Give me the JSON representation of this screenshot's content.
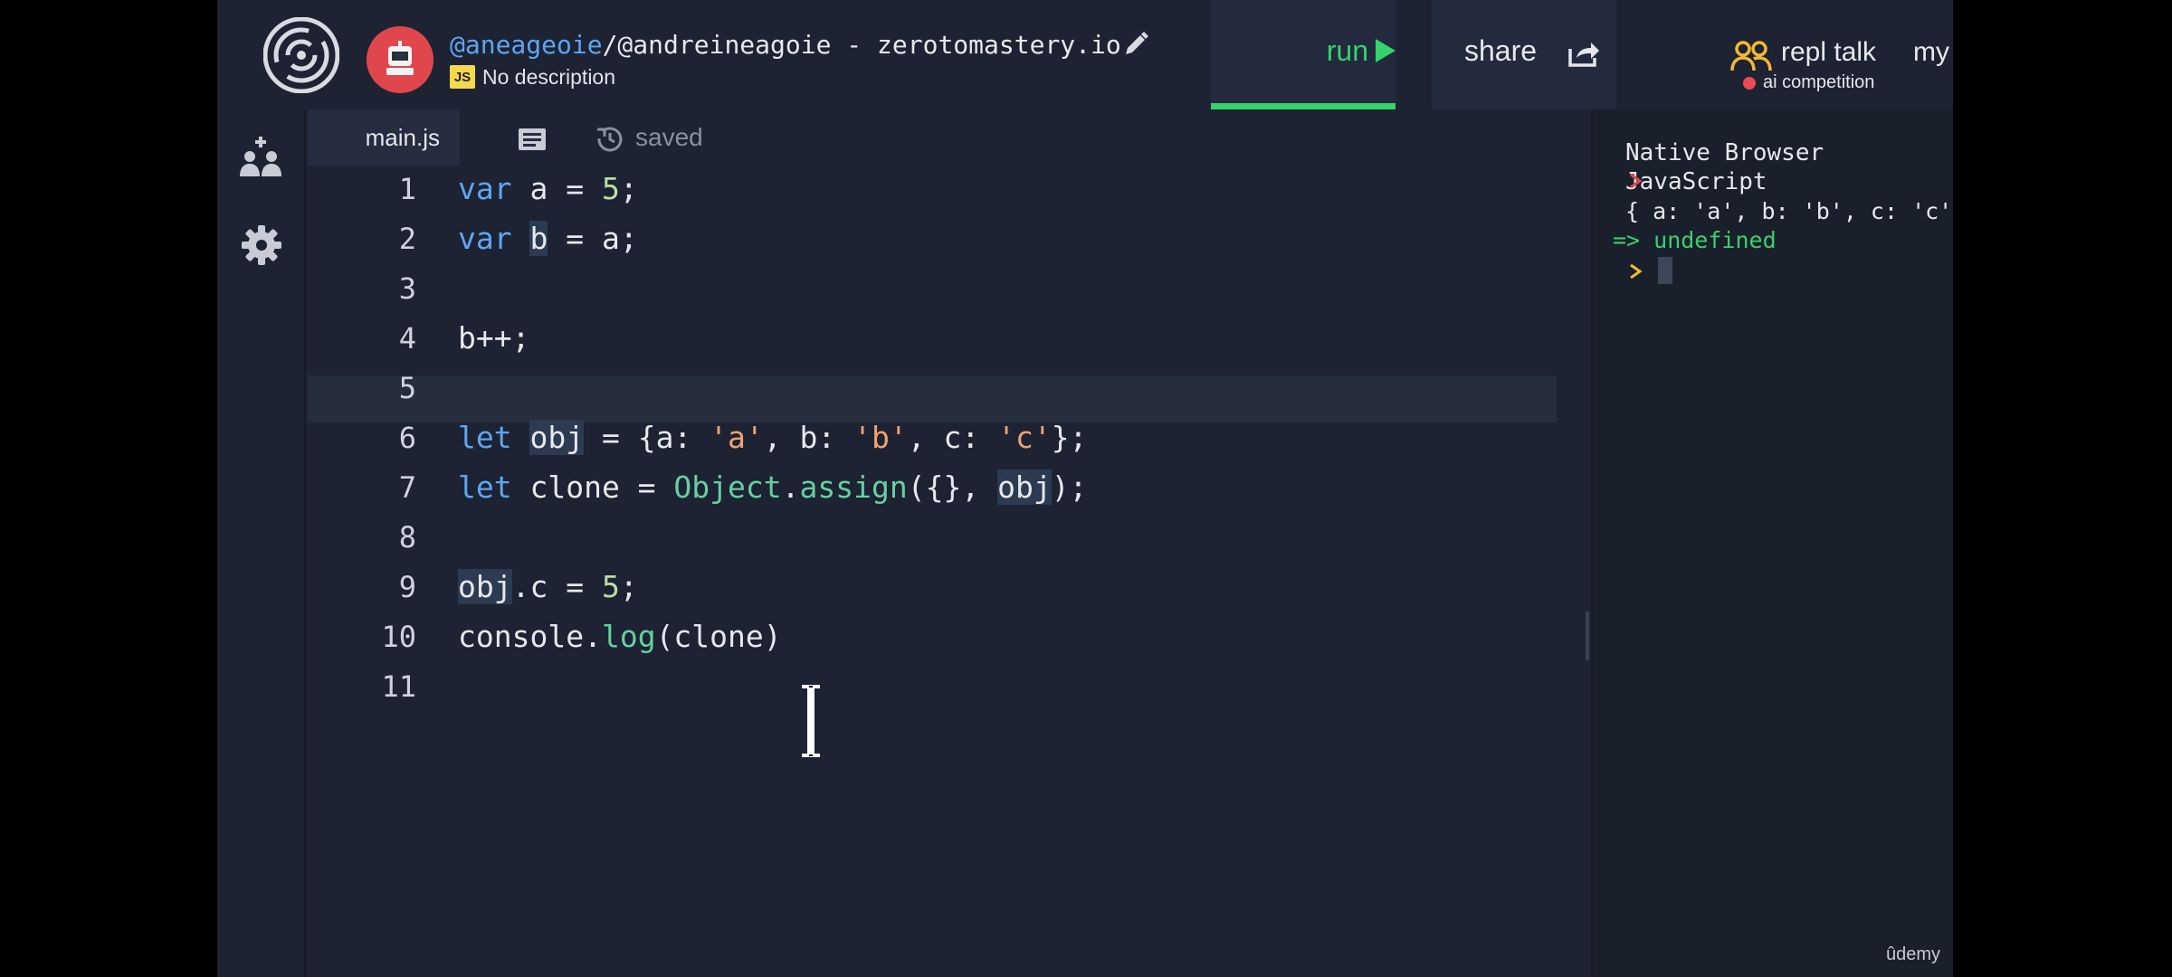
{
  "header": {
    "owner": "@aneageoie",
    "repl_path": "/@andreineagoie - zerotomastery.io",
    "language_badge": "JS",
    "description": "No description",
    "run_label": "run",
    "share_label": "share",
    "talk_label": "repl talk",
    "talk_sub": "ai competition",
    "my_label": "my"
  },
  "tabs": {
    "active_file": "main.js",
    "status": "saved"
  },
  "editor": {
    "active_line": 9,
    "lines": [
      "var a = 5;",
      "var b = a;",
      "",
      "b++;",
      "",
      "let obj = {a: 'a', b: 'b', c: 'c'};",
      "let clone = Object.assign({}, obj);",
      "",
      "obj.c = 5;",
      "console.log(clone)",
      ""
    ]
  },
  "console": {
    "title": "Native Browser JavaScript",
    "output": "{ a: 'a', b: 'b', c: 'c' }",
    "result": "=> undefined"
  },
  "watermark": "ûdemy",
  "colors": {
    "run_green": "#38d16b",
    "keyword_blue": "#5ea6f0",
    "string_orange": "#f0a36f",
    "number_green": "#b9e0a6",
    "avatar_red": "#e0474c"
  }
}
